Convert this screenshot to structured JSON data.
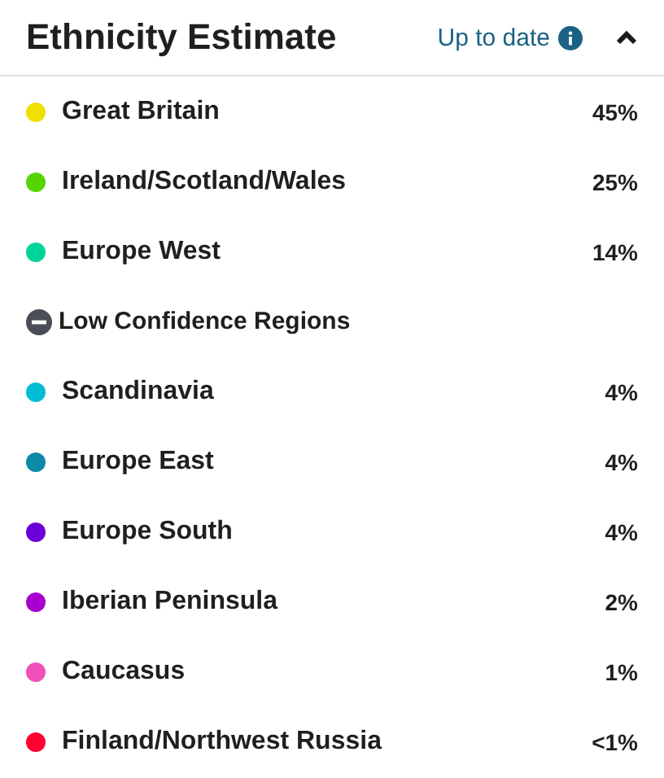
{
  "header": {
    "title": "Ethnicity Estimate",
    "status": "Up to date",
    "expanded": true
  },
  "rows": [
    {
      "kind": "region",
      "name": "Great Britain",
      "percent": "45%",
      "color": "#f0e000"
    },
    {
      "kind": "region",
      "name": "Ireland/Scotland/Wales",
      "percent": "25%",
      "color": "#55d400"
    },
    {
      "kind": "region",
      "name": "Europe West",
      "percent": "14%",
      "color": "#00d49a"
    },
    {
      "kind": "group",
      "name": "Low Confidence Regions",
      "expanded": true
    },
    {
      "kind": "region",
      "name": "Scandinavia",
      "percent": "4%",
      "color": "#00bcd4"
    },
    {
      "kind": "region",
      "name": "Europe East",
      "percent": "4%",
      "color": "#0c8aa8"
    },
    {
      "kind": "region",
      "name": "Europe South",
      "percent": "4%",
      "color": "#6a00d8"
    },
    {
      "kind": "region",
      "name": "Iberian Peninsula",
      "percent": "2%",
      "color": "#a800d0"
    },
    {
      "kind": "region",
      "name": "Caucasus",
      "percent": "1%",
      "color": "#f050b8"
    },
    {
      "kind": "region",
      "name": "Finland/Northwest Russia",
      "percent": "<1%",
      "color": "#ff0030"
    }
  ]
}
